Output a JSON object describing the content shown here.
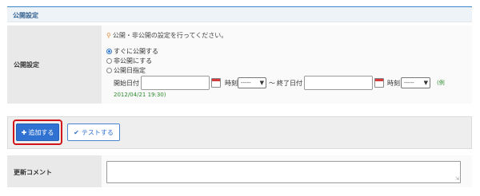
{
  "section": {
    "title": "公開設定"
  },
  "publish": {
    "label": "公開設定",
    "hint": "公開・非公開の設定を行ってください。",
    "hint_icon": "pin-icon",
    "options": [
      {
        "label": "すぐに公開する",
        "selected": true
      },
      {
        "label": "非公開にする",
        "selected": false
      },
      {
        "label": "公開日指定",
        "selected": false
      }
    ],
    "start_date_label": "開始日付",
    "start_time_label": "時刻",
    "start_time_value": "-----",
    "range_separator": "～",
    "end_date_label": "終了日付",
    "end_time_label": "時刻",
    "end_time_value": "-----",
    "example_prefix": "(例",
    "example_value": "2012/04/21 19:30)"
  },
  "buttons": {
    "add_label": "追加する",
    "add_icon": "plus-icon",
    "test_label": "テストする",
    "test_icon": "check-icon"
  },
  "comment": {
    "label": "更新コメント",
    "value": ""
  },
  "colors": {
    "primary": "#2f72d2",
    "focus_ring": "#d0141a",
    "example_text": "#2e8b2e",
    "header_border": "#3a86c8"
  }
}
